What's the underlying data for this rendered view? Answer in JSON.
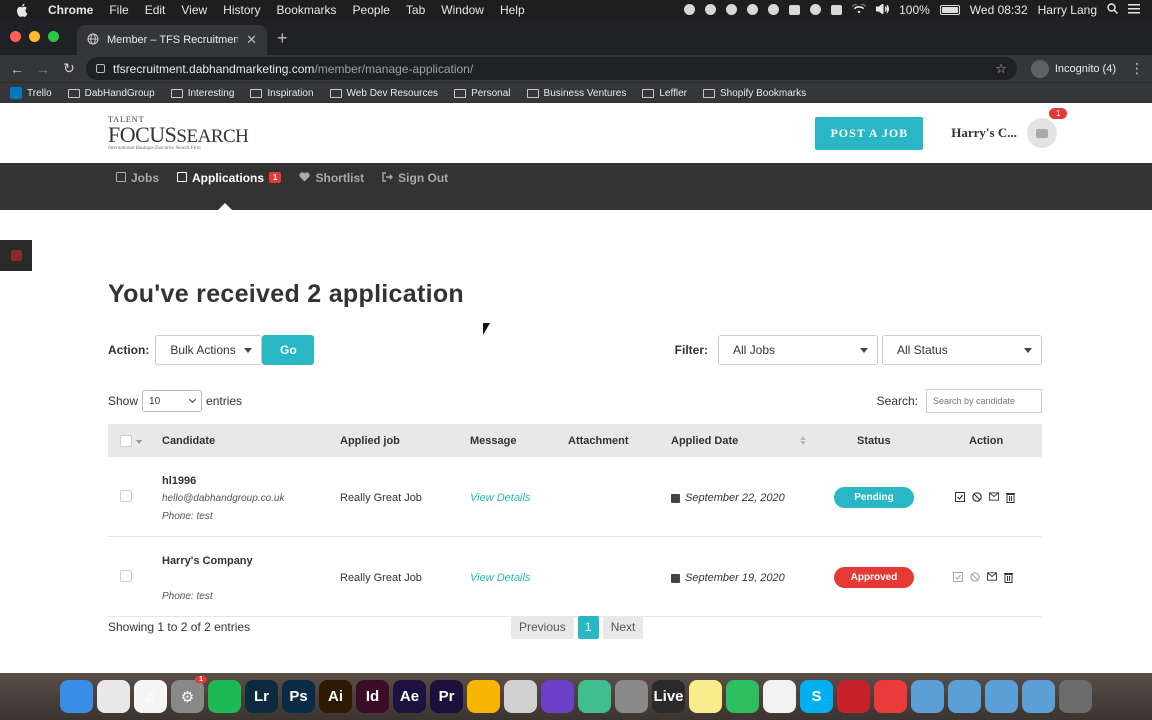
{
  "menubar": {
    "app": "Chrome",
    "items": [
      "File",
      "Edit",
      "View",
      "History",
      "Bookmarks",
      "People",
      "Tab",
      "Window",
      "Help"
    ],
    "battery": "100%",
    "clock": "Wed 08:32",
    "user": "Harry Lang"
  },
  "browser": {
    "tab_title": "Member – TFS Recruitment",
    "url_host": "tfsrecruitment.dabhandmarketing.com",
    "url_path": "/member/manage-application/",
    "incognito": "Incognito (4)",
    "bookmarks": [
      "Trello",
      "DabHandGroup",
      "Interesting",
      "Inspiration",
      "Web Dev Resources",
      "Personal",
      "Business Ventures",
      "Leffler",
      "Shopify Bookmarks"
    ]
  },
  "header": {
    "logo_top": "TALENT",
    "logo_main_a": "FOCUS",
    "logo_main_b": "SEARCH",
    "logo_tag": "International Boutique Executive Search Firm",
    "post_job": "POST A JOB",
    "company": "Harry's C...",
    "notif_count": "1"
  },
  "nav": {
    "items": [
      {
        "label": "Jobs"
      },
      {
        "label": "Applications",
        "badge": "1"
      },
      {
        "label": "Shortlist"
      },
      {
        "label": "Sign Out"
      }
    ]
  },
  "main": {
    "heading": "You've received 2 application",
    "action_label": "Action:",
    "bulk_actions": "Bulk Actions",
    "go": "Go",
    "filter_label": "Filter:",
    "filter_jobs": "All Jobs",
    "filter_status": "All Status",
    "show": "Show",
    "entries_value": "10",
    "entries": "entries",
    "search_label": "Search:",
    "search_placeholder": "Search by candidate",
    "columns": [
      "Candidate",
      "Applied job",
      "Message",
      "Attachment",
      "Applied Date",
      "Status",
      "Action"
    ],
    "rows": [
      {
        "name": "hl1996",
        "email": "hello@dabhandgroup.co.uk",
        "phone": "Phone: test",
        "job": "Really Great Job",
        "message": "View Details",
        "date": "September 22, 2020",
        "status": "Pending",
        "status_color": "#29b6c5"
      },
      {
        "name": "Harry's Company",
        "email": "",
        "phone": "Phone: test",
        "job": "Really Great Job",
        "message": "View Details",
        "date": "September 19, 2020",
        "status": "Approved",
        "status_color": "#e53935"
      }
    ],
    "showing": "Showing 1 to 2 of 2 entries",
    "pager": {
      "prev": "Previous",
      "current": "1",
      "next": "Next"
    }
  },
  "dock": {
    "apps": [
      {
        "name": "finder",
        "color": "#3a8ee6",
        "glyph": ""
      },
      {
        "name": "chrome",
        "color": "#e8e8e8",
        "glyph": ""
      },
      {
        "name": "itunes",
        "color": "#f5f5f5",
        "glyph": "♫"
      },
      {
        "name": "system-preferences",
        "color": "#888888",
        "glyph": "⚙",
        "badge": "1"
      },
      {
        "name": "spotify",
        "color": "#1db954",
        "glyph": ""
      },
      {
        "name": "lightroom",
        "color": "#0d2a3e",
        "glyph": "Lr"
      },
      {
        "name": "photoshop",
        "color": "#0a2b45",
        "glyph": "Ps"
      },
      {
        "name": "illustrator",
        "color": "#2e1a04",
        "glyph": "Ai"
      },
      {
        "name": "indesign",
        "color": "#3b0c24",
        "glyph": "Id"
      },
      {
        "name": "after-effects",
        "color": "#1b1240",
        "glyph": "Ae"
      },
      {
        "name": "premiere",
        "color": "#1b0f3c",
        "glyph": "Pr"
      },
      {
        "name": "sketch",
        "color": "#f7b500",
        "glyph": ""
      },
      {
        "name": "tableplus",
        "color": "#d0d0d0",
        "glyph": ""
      },
      {
        "name": "github",
        "color": "#6e40c9",
        "glyph": ""
      },
      {
        "name": "atom",
        "color": "#3fbf8f",
        "glyph": ""
      },
      {
        "name": "preview",
        "color": "#8a8a8a",
        "glyph": ""
      },
      {
        "name": "ableton",
        "color": "#2a2a2a",
        "glyph": "Live"
      },
      {
        "name": "notes",
        "color": "#f8ec8c",
        "glyph": ""
      },
      {
        "name": "evernote",
        "color": "#2dbe60",
        "glyph": ""
      },
      {
        "name": "slack",
        "color": "#f2f2f2",
        "glyph": ""
      },
      {
        "name": "skype",
        "color": "#00aff0",
        "glyph": "S"
      },
      {
        "name": "parallels",
        "color": "#c7222a",
        "glyph": ""
      },
      {
        "name": "creative-cloud",
        "color": "#ea3b3b",
        "glyph": ""
      },
      {
        "name": "app-store-folder",
        "color": "#5b9fd6",
        "glyph": ""
      },
      {
        "name": "folder-1",
        "color": "#5b9fd6",
        "glyph": ""
      },
      {
        "name": "downloads-folder",
        "color": "#5b9fd6",
        "glyph": ""
      },
      {
        "name": "folder-2",
        "color": "#5b9fd6",
        "glyph": ""
      },
      {
        "name": "trash",
        "color": "#6b6b6b",
        "glyph": ""
      }
    ]
  }
}
